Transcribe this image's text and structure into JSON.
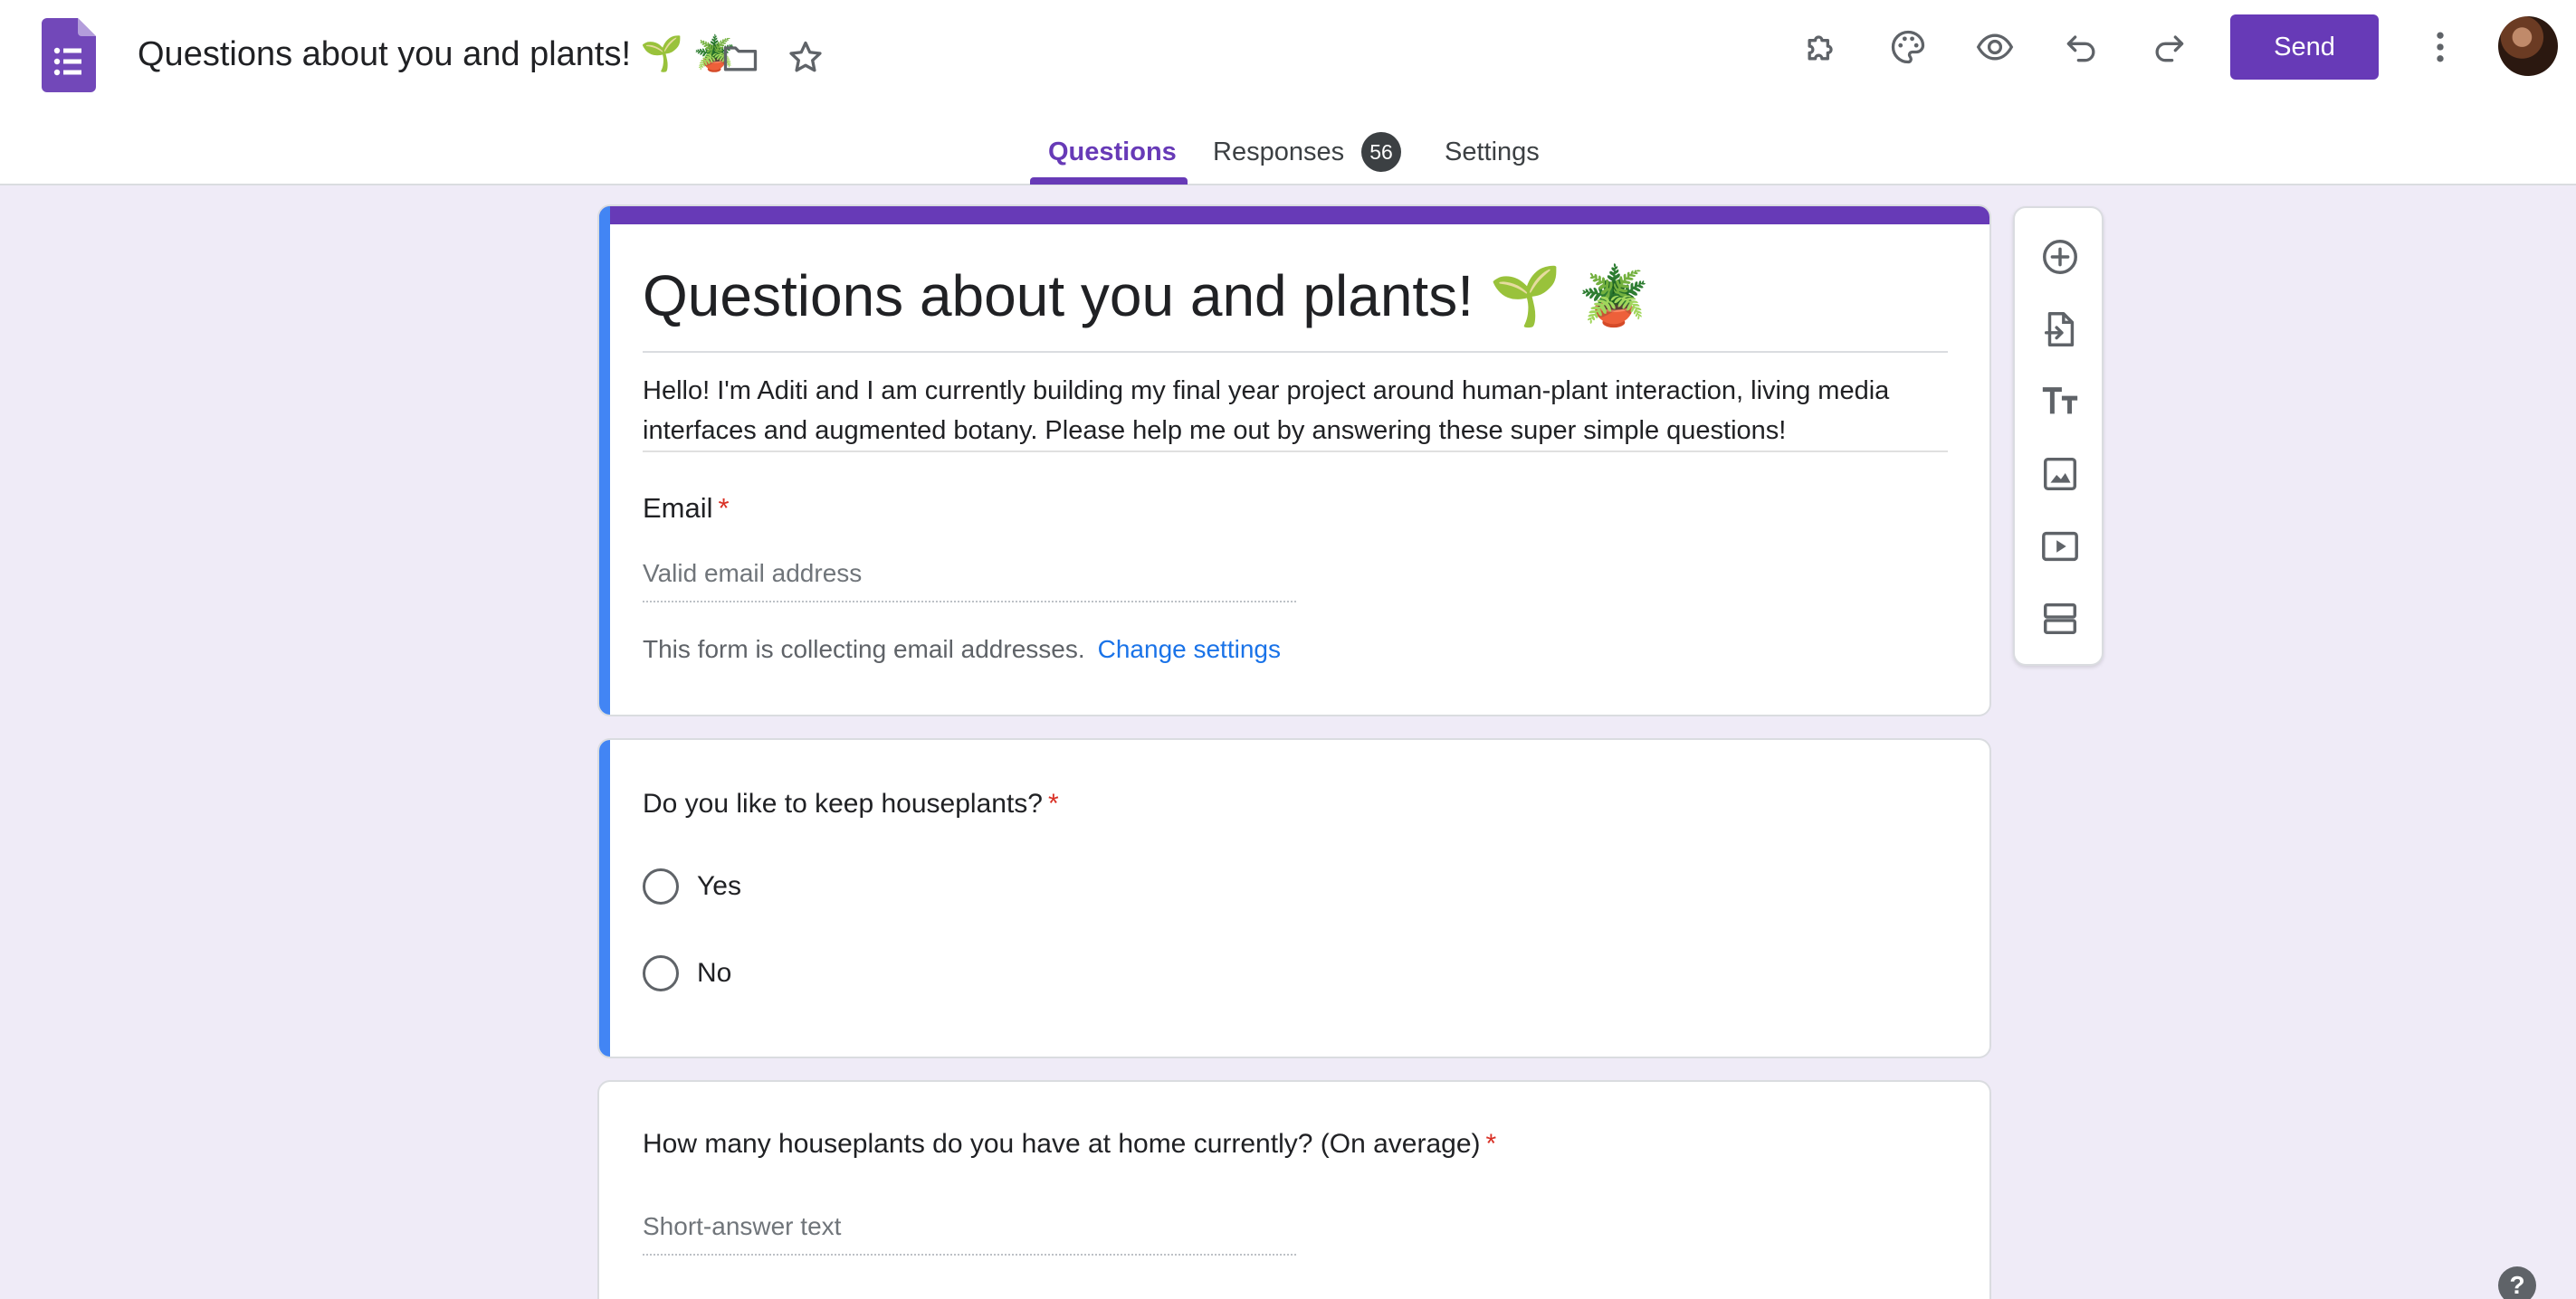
{
  "header": {
    "doc_title": "Questions about you and plants! 🌱 🪴",
    "send_label": "Send",
    "icons": {
      "app": "google-forms-icon",
      "folder": "folder-icon",
      "star": "star-icon",
      "addons": "puzzle-icon",
      "theme": "palette-icon",
      "preview": "eye-icon",
      "undo": "undo-icon",
      "redo": "redo-icon",
      "more": "more-vert-icon"
    }
  },
  "tabs": {
    "questions": "Questions",
    "responses": "Responses",
    "responses_count": "56",
    "settings": "Settings"
  },
  "form": {
    "title": "Questions about you and plants! 🌱 🪴",
    "description": "Hello! I'm Aditi and I am currently building my final year project around human-plant interaction, living media interfaces and augmented botany. Please help me out by answering these super simple questions!",
    "email": {
      "label": "Email",
      "required_mark": "*",
      "placeholder": "Valid email address",
      "note": "This form is collecting email addresses.",
      "change_link": "Change settings"
    },
    "questions": [
      {
        "title": "Do you like to keep houseplants?",
        "required_mark": "*",
        "options": [
          "Yes",
          "No"
        ]
      },
      {
        "title": "How many houseplants do you have at home currently? (On average)",
        "required_mark": "*",
        "placeholder": "Short-answer text"
      }
    ]
  },
  "side_toolbar": [
    "add-question-icon",
    "import-questions-icon",
    "add-title-icon",
    "add-image-icon",
    "add-video-icon",
    "add-section-icon"
  ],
  "colors": {
    "accent": "#673ab7",
    "active_card": "#4285f4",
    "background": "#efebf7",
    "required": "#d93025",
    "link": "#1a73e8"
  }
}
